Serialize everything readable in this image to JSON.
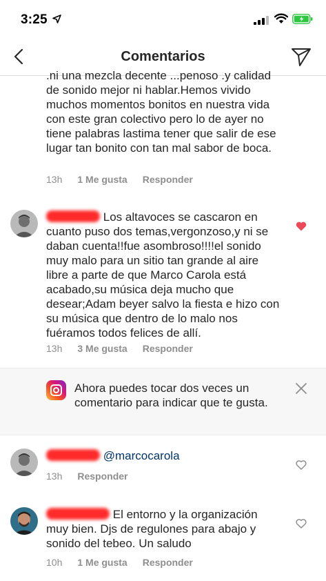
{
  "status_bar": {
    "time": "3:25"
  },
  "nav": {
    "title": "Comentarios"
  },
  "comments": [
    {
      "text": ".ni una mezcla decente ...penoso .y calidad de sonido mejor ni hablar.Hemos vivido muchos momentos bonitos en nuestra vida con este gran colectivo pero lo de ayer no tiene palabras lastima tener que salir de ese lugar tan bonito con tan mal sabor de boca.",
      "time": "13h",
      "likes": "1 Me gusta",
      "reply": "Responder"
    },
    {
      "text": "Los altavoces se cascaron en cuanto puso dos temas,vergonzoso,y ni se daban cuenta!!fue asombroso!!!!el sonido muy malo para un sitio tan grande al aire libre a parte de que Marco Carola está acabado,su música deja mucho que desear;Adam beyer salvo la fiesta e hizo con su música que dentro de lo malo nos fuéramos todos felices de allí.",
      "time": "13h",
      "likes": "3 Me gusta",
      "reply": "Responder",
      "liked": true
    },
    {
      "text": "@marcocarola",
      "time": "13h",
      "reply": "Responder"
    },
    {
      "text": "El entorno y la organización muy bien. Djs de regulones para abajo y sonido del tebeo. Un saludo",
      "time": "10h",
      "likes": "1 Me gusta",
      "reply": "Responder"
    }
  ],
  "notice": {
    "text": "Ahora puedes tocar dos veces un comentario para indicar que te gusta."
  },
  "colors": {
    "liked_heart": "#ed4956",
    "mention": "#003569",
    "meta_gray": "#8e8e8e",
    "redaction": "#ff2a2a"
  },
  "icons": [
    "location-arrow-icon",
    "signal-icon",
    "wifi-icon",
    "battery-icon",
    "back-chevron-icon",
    "send-direct-icon",
    "heart-filled-icon",
    "heart-outline-icon",
    "instagram-icon",
    "close-icon"
  ]
}
